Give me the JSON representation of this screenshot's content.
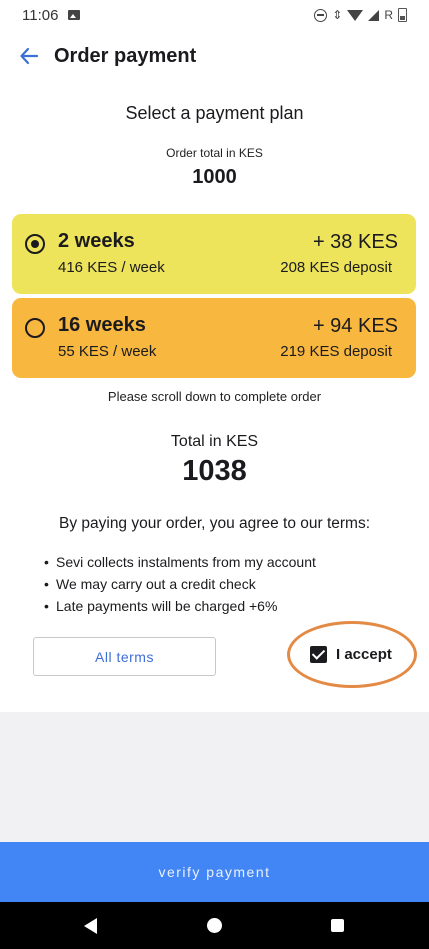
{
  "status_bar": {
    "time": "11:06",
    "network_label": "R",
    "icons": [
      "gallery-icon",
      "do-not-disturb-icon",
      "data-arrows-icon",
      "wifi-icon",
      "signal-icon",
      "battery-icon"
    ]
  },
  "app_bar": {
    "title": "Order payment",
    "back_icon": "back-arrow-icon"
  },
  "plan_section": {
    "title": "Select a payment plan",
    "order_total_label": "Order total in KES",
    "order_total_value": "1000"
  },
  "plans": [
    {
      "duration": "2 weeks",
      "weekly": "416 KES / week",
      "fee": "+ 38 KES",
      "deposit": "208 KES deposit",
      "selected": true,
      "color": "#ede45b"
    },
    {
      "duration": "16 weeks",
      "weekly": "55 KES / week",
      "fee": "+ 94 KES",
      "deposit": "219 KES deposit",
      "selected": false,
      "color": "#f8b73f"
    }
  ],
  "scroll_hint": "Please scroll down to complete order",
  "total": {
    "label": "Total in KES",
    "value": "1038"
  },
  "terms": {
    "intro": "By paying your order, you agree to our terms:",
    "items": [
      "Sevi collects instalments from my account",
      "We may carry out a credit check",
      "Late payments will be charged +6%"
    ],
    "all_terms_label": "All terms",
    "accept_label": "I accept",
    "accepted": true,
    "highlight_color": "#e38a45"
  },
  "verify_button_label": "verify payment",
  "nav_bar": {
    "icons": [
      "nav-back-icon",
      "nav-home-icon",
      "nav-recents-icon"
    ]
  },
  "colors": {
    "accent": "#4285f4",
    "link": "#3e6fd8"
  }
}
